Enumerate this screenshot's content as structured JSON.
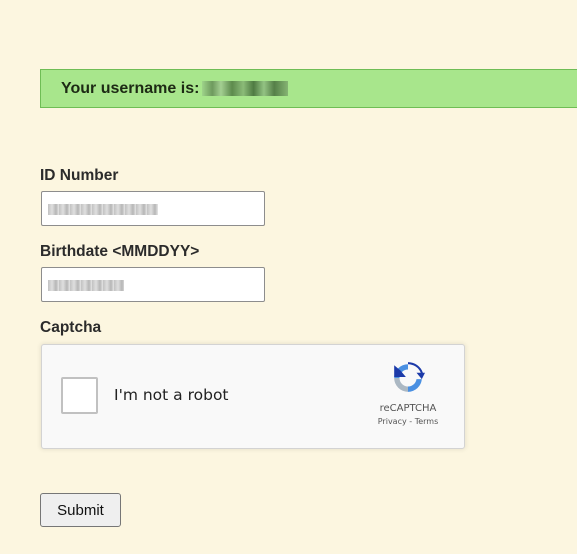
{
  "banner": {
    "text": "Your username is:",
    "value_redacted": true,
    "background_color": "#a8e68c"
  },
  "form": {
    "id_number": {
      "label": "ID Number",
      "value_redacted": true
    },
    "birthdate": {
      "label": "Birthdate <MMDDYY>",
      "value_redacted": true
    },
    "captcha": {
      "label": "Captcha",
      "checkbox_text": "I'm not a robot",
      "brand": "reCAPTCHA",
      "links": "Privacy - Terms",
      "icon": "recaptcha-logo-icon"
    },
    "submit_label": "Submit"
  },
  "colors": {
    "page_background": "#fcf6e0",
    "banner_border": "#6fbd55"
  }
}
